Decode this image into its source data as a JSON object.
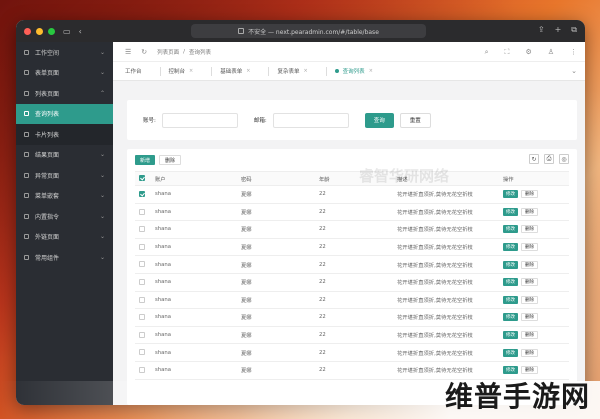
{
  "browser": {
    "url": "不安全 — next.pearadmin.com/#/table/base",
    "traffic_colors": [
      "#ff5f57",
      "#febc2e",
      "#28c840"
    ]
  },
  "sidebar": {
    "items": [
      {
        "label": "工作空间",
        "state": "normal",
        "chevron": "⌄"
      },
      {
        "label": "表单页面",
        "state": "normal",
        "chevron": "⌄"
      },
      {
        "label": "列表页面",
        "state": "normal",
        "chevron": "⌃"
      },
      {
        "label": "查询列表",
        "state": "active",
        "chevron": ""
      },
      {
        "label": "卡片列表",
        "state": "sub",
        "chevron": ""
      },
      {
        "label": "结果页面",
        "state": "normal",
        "chevron": "⌄"
      },
      {
        "label": "异常页面",
        "state": "normal",
        "chevron": "⌄"
      },
      {
        "label": "菜单嵌套",
        "state": "normal",
        "chevron": "⌄"
      },
      {
        "label": "内置指令",
        "state": "normal",
        "chevron": "⌄"
      },
      {
        "label": "外链页面",
        "state": "normal",
        "chevron": "⌄"
      },
      {
        "label": "常用组件",
        "state": "normal",
        "chevron": "⌄"
      }
    ]
  },
  "topnav": {
    "breadcrumb_1": "列表页面",
    "breadcrumb_sep": "/",
    "breadcrumb_2": "查询列表"
  },
  "tabs": [
    {
      "label": "工作台",
      "active": false,
      "closable": false
    },
    {
      "label": "控制台",
      "active": false,
      "closable": true
    },
    {
      "label": "基础表单",
      "active": false,
      "closable": true
    },
    {
      "label": "复杂表单",
      "active": false,
      "closable": true
    },
    {
      "label": "查询列表",
      "active": true,
      "closable": true
    }
  ],
  "search": {
    "account_label": "账号:",
    "email_label": "邮箱:",
    "query_button": "查询",
    "reset_button": "重置"
  },
  "table": {
    "add_button": "新增",
    "delete_button": "删除",
    "watermark": "睿智华研网络",
    "columns": [
      "账户",
      "密码",
      "年龄",
      "描述",
      "操作"
    ],
    "rows": [
      {
        "checked": true,
        "account": "shana",
        "password": "夏娜",
        "age": "22",
        "desc": "花开堪折直须折,莫待无花空折枝"
      },
      {
        "checked": false,
        "account": "shana",
        "password": "夏娜",
        "age": "22",
        "desc": "花开堪折直须折,莫待无花空折枝"
      },
      {
        "checked": false,
        "account": "shana",
        "password": "夏娜",
        "age": "22",
        "desc": "花开堪折直须折,莫待无花空折枝"
      },
      {
        "checked": false,
        "account": "shana",
        "password": "夏娜",
        "age": "22",
        "desc": "花开堪折直须折,莫待无花空折枝"
      },
      {
        "checked": false,
        "account": "shana",
        "password": "夏娜",
        "age": "22",
        "desc": "花开堪折直须折,莫待无花空折枝"
      },
      {
        "checked": false,
        "account": "shana",
        "password": "夏娜",
        "age": "22",
        "desc": "花开堪折直须折,莫待无花空折枝"
      },
      {
        "checked": false,
        "account": "shana",
        "password": "夏娜",
        "age": "22",
        "desc": "花开堪折直须折,莫待无花空折枝"
      },
      {
        "checked": false,
        "account": "shana",
        "password": "夏娜",
        "age": "22",
        "desc": "花开堪折直须折,莫待无花空折枝"
      },
      {
        "checked": false,
        "account": "shana",
        "password": "夏娜",
        "age": "22",
        "desc": "花开堪折直须折,莫待无花空折枝"
      },
      {
        "checked": false,
        "account": "shana",
        "password": "夏娜",
        "age": "22",
        "desc": "花开堪折直须折,莫待无花空折枝"
      },
      {
        "checked": false,
        "account": "shana",
        "password": "夏娜",
        "age": "22",
        "desc": "花开堪折直须折,莫待无花空折枝"
      }
    ],
    "edit_label": "修改",
    "remove_label": "删除",
    "pager_text": "[ ^ ]"
  },
  "brand_text": "维普手游网",
  "colors": {
    "accent": "#2e9b8c",
    "sidebar_bg": "#2a2d33"
  }
}
